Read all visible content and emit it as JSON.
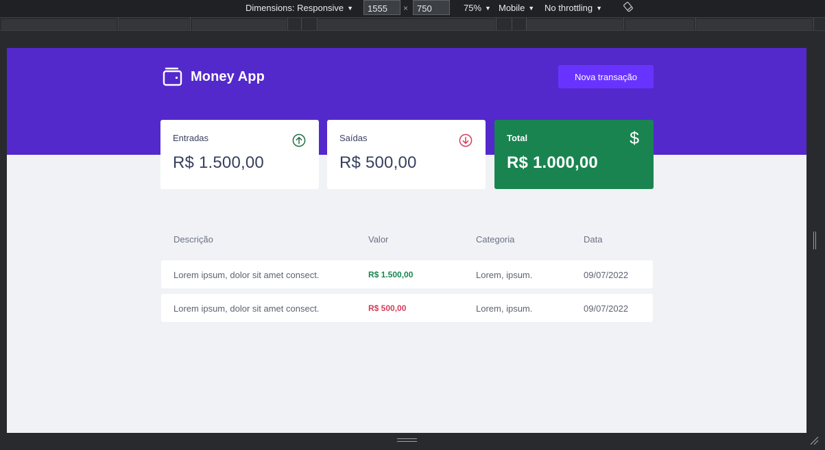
{
  "devtools": {
    "dimensions_label": "Dimensions: Responsive",
    "width_value": "1555",
    "height_value": "750",
    "times_symbol": "×",
    "zoom_label": "75%",
    "device_label": "Mobile",
    "throttling_label": "No throttling"
  },
  "app": {
    "title": "Money App",
    "new_transaction_label": "Nova transação",
    "colors": {
      "header_bg": "#5429cc",
      "button_bg": "#6933ff",
      "total_bg": "#198450",
      "income": "#198450",
      "outcome": "#d43b5a",
      "page_bg": "#f0f2f5"
    }
  },
  "summary": {
    "income": {
      "label": "Entradas",
      "value": "R$ 1.500,00",
      "icon": "arrow-up-circle-icon"
    },
    "outcome": {
      "label": "Saídas",
      "value": "R$ 500,00",
      "icon": "arrow-down-circle-icon"
    },
    "total": {
      "label": "Total",
      "value": "R$ 1.000,00",
      "icon": "dollar-sign-icon",
      "symbol": "$"
    }
  },
  "table": {
    "headers": [
      "Descrição",
      "Valor",
      "Categoria",
      "Data"
    ],
    "rows": [
      {
        "description": "Lorem ipsum, dolor sit amet consect.",
        "value": "R$ 1.500,00",
        "type": "deposit",
        "category": "Lorem, ipsum.",
        "date": "09/07/2022"
      },
      {
        "description": "Lorem ipsum, dolor sit amet consect.",
        "value": "R$ 500,00",
        "type": "withdraw",
        "category": "Lorem, ipsum.",
        "date": "09/07/2022"
      }
    ]
  }
}
